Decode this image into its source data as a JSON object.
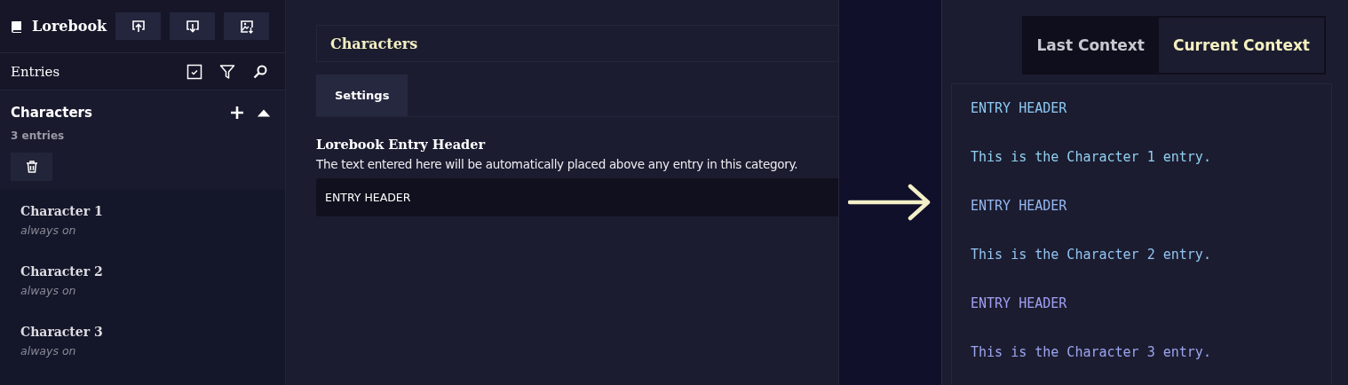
{
  "sidebar": {
    "title": "Lorebook",
    "entries_label": "Entries",
    "category": {
      "name": "Characters",
      "count": "3 entries"
    },
    "entries": [
      {
        "name": "Character 1",
        "status": "always on"
      },
      {
        "name": "Character 2",
        "status": "always on"
      },
      {
        "name": "Character 3",
        "status": "always on"
      }
    ]
  },
  "editor": {
    "title": "Characters",
    "tabs": [
      {
        "label": "Settings",
        "selected": true
      }
    ],
    "field_heading": "Lorebook Entry Header",
    "field_description": "The text entered here will be automatically placed above any entry in this category.",
    "field_value": "ENTRY HEADER"
  },
  "context": {
    "tabs": [
      {
        "label": "Last Context",
        "selected": false
      },
      {
        "label": "Current Context",
        "selected": true
      }
    ],
    "lines": [
      {
        "text": "ENTRY HEADER",
        "color": "#8ccaf2"
      },
      {
        "text": "This is the Character 1 entry.",
        "color": "#90d0f0"
      },
      {
        "text": "ENTRY HEADER",
        "color": "#94b8f2"
      },
      {
        "text": "This is the Character 2 entry.",
        "color": "#92c4f0"
      },
      {
        "text": "ENTRY HEADER",
        "color": "#a0a0f4"
      },
      {
        "text": "This is the Character 3 entry.",
        "color": "#9ca6f0"
      }
    ]
  }
}
